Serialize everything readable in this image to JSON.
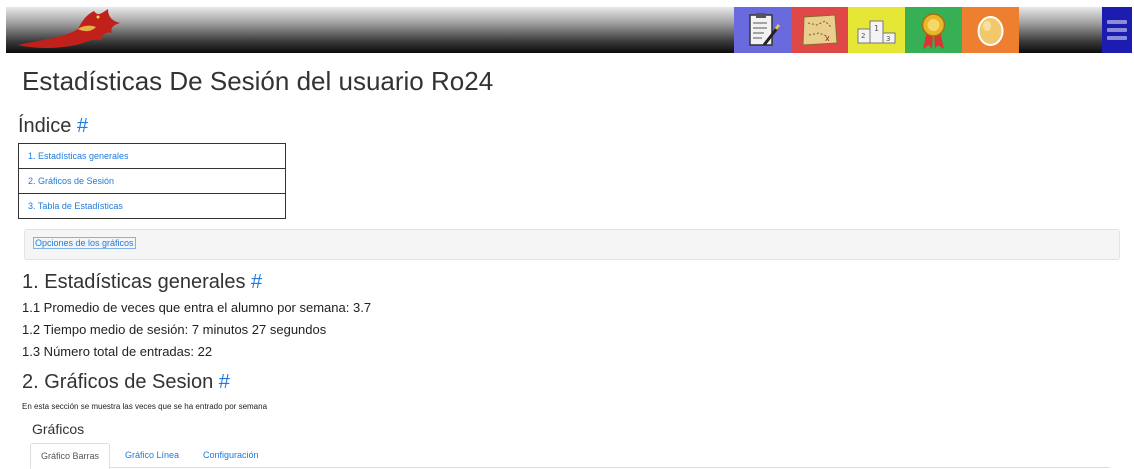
{
  "header": {
    "logo": "dragon-logo",
    "nav_tiles": [
      {
        "icon": "clipboard-icon",
        "color": "#6a6adf"
      },
      {
        "icon": "map-icon",
        "color": "#e04848"
      },
      {
        "icon": "podium-icon",
        "color": "#e6e637"
      },
      {
        "icon": "medal-icon",
        "color": "#37b055"
      },
      {
        "icon": "egg-icon",
        "color": "#ee7e30"
      }
    ],
    "menu_icon": "hamburger-menu-icon"
  },
  "page_title": "Estadísticas De Sesión del usuario Ro24",
  "index": {
    "title": "Índice",
    "anchor": "#",
    "items": [
      "1. Estadísticas generales",
      "2. Gráficos de Sesión",
      "3. Tabla de Estadísticas"
    ]
  },
  "options_link": "Opciones de los gráficos",
  "section1": {
    "title": "1. Estadísticas generales",
    "anchor": "#",
    "stats": [
      "1.1 Promedio de veces que entra el alumno por semana: 3.7",
      "1.2 Tiempo medio de sesión: 7 minutos 27 segundos",
      "1.3 Número total de entradas: 22"
    ]
  },
  "section2": {
    "title": "2. Gráficos de Sesion",
    "anchor": "#",
    "description": "En esta sección se muestra las veces que se ha entrado por semana",
    "graficos_label": "Gráficos",
    "tabs": [
      "Gráfico Barras",
      "Gráfico Línea",
      "Configuración"
    ]
  }
}
